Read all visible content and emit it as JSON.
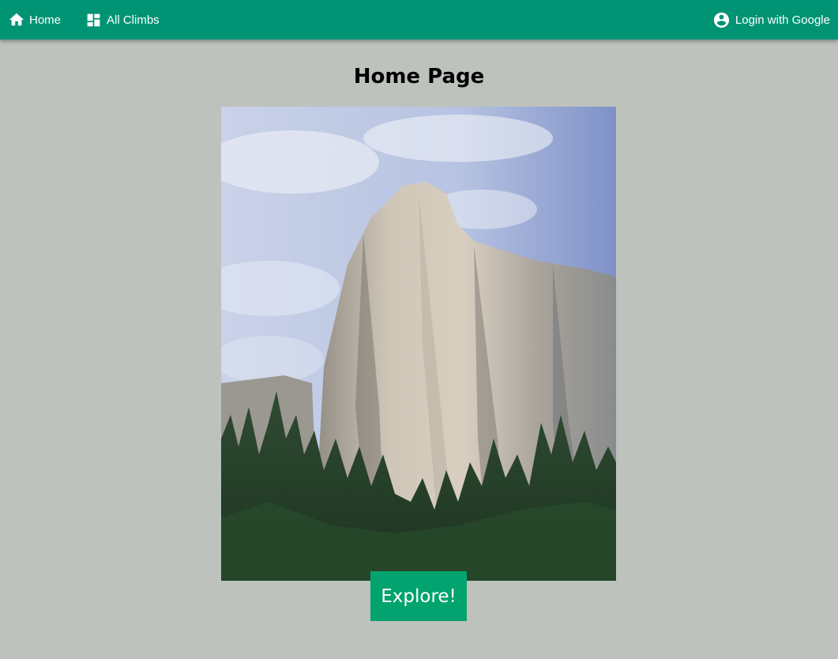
{
  "nav": {
    "home_label": "Home",
    "home_icon": "home-icon",
    "climbs_label": "All Climbs",
    "climbs_icon": "dashboard-icon",
    "login_label": "Login with Google",
    "login_icon": "account-circle-icon"
  },
  "main": {
    "title": "Home Page",
    "explore_label": "Explore!"
  },
  "colors": {
    "navbar": "#009474",
    "background": "#bdc2bd",
    "button": "#03a36f"
  }
}
